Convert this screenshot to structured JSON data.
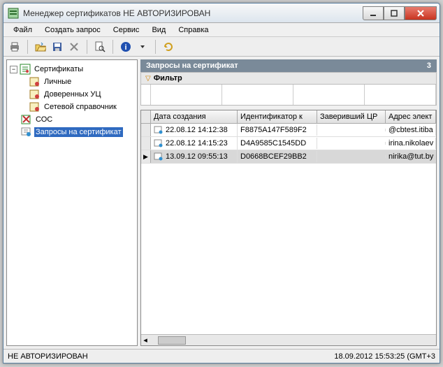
{
  "title": "Менеджер сертификатов   НЕ АВТОРИЗИРОВАН",
  "menu": [
    "Файл",
    "Создать запрос",
    "Сервис",
    "Вид",
    "Справка"
  ],
  "tree": {
    "root": "Сертификаты",
    "children": [
      {
        "label": "Личные"
      },
      {
        "label": "Доверенных УЦ"
      },
      {
        "label": "Сетевой справочник"
      }
    ],
    "cos": "СОС",
    "requests": "Запросы на сертификат"
  },
  "panel": {
    "title": "Запросы на сертификат",
    "count": "3",
    "filter_label": "Фильтр"
  },
  "grid": {
    "headers": [
      "Дата создания",
      "Идентификатор к",
      "Заверивший ЦР",
      "Адрес элект"
    ],
    "rows": [
      {
        "date": "22.08.12 14:12:38",
        "id": "F8875A147F589F2",
        "signer": "",
        "email": "@cbtest.itiba"
      },
      {
        "date": "22.08.12 14:15:23",
        "id": "D4A9585C1545DD",
        "signer": "",
        "email": "irina.nikolaev"
      },
      {
        "date": "13.09.12 09:55:13",
        "id": "D0668BCEF29BB2",
        "signer": "",
        "email": "nirika@tut.by"
      }
    ]
  },
  "status": {
    "left": "НЕ АВТОРИЗИРОВАН",
    "right": "18.09.2012 15:53:25 (GMT+3"
  }
}
